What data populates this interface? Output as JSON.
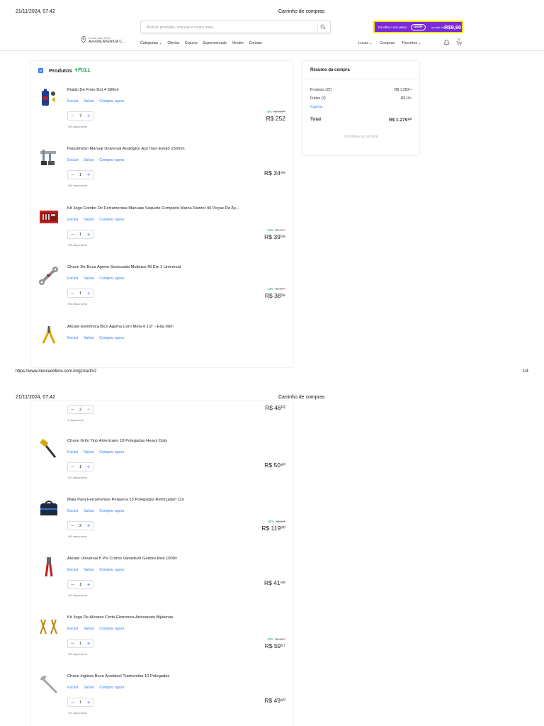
{
  "print": {
    "datetime": "21/11/2024, 07:42",
    "title": "Carrinho de compras",
    "url": "https://www.mercadolivre.com.br/gz/cart/v2",
    "page_label": "1/4"
  },
  "header": {
    "search_placeholder": "Buscar produtos, marcas e muito mais…",
    "promo_text": "Escolha o seu plano",
    "promo_pill": "meli+",
    "promo_from": "a partir de",
    "promo_price": "R$9,90",
    "address_line1": "Enviar para VEIA",
    "address_line2": "Avenida AVENIDA C...",
    "nav": [
      "Categorias ⌄",
      "Ofertas",
      "Cupons",
      "Supermercado",
      "Vender",
      "Contato"
    ],
    "user_nav": [
      "Lucas ⌄",
      "Compras",
      "Favoritos ⌄"
    ],
    "cart_label": "22"
  },
  "cart": {
    "title": "Produtos",
    "full_badge": "FULL",
    "items_page1": [
      {
        "title": "Fluido De Freio Dot 4 500ml",
        "qty": "7",
        "available": "+50 disponíveis",
        "discount": "-8%",
        "old_price": "R$ 283⁰⁰",
        "price": "R$ 252",
        "actions": [
          "Excluir",
          "Salvar",
          "Comprar agora"
        ]
      },
      {
        "title": "Paquímetro Manual Universal Analógico Aço Inox Estojo 150mm",
        "qty": "1",
        "available": "+50 disponíveis",
        "discount": "",
        "old_price": "",
        "price": "R$ 34⁹⁹",
        "actions": [
          "Excluir",
          "Salvar",
          "Comprar agora"
        ]
      },
      {
        "title": "Kit Jogo Combo De Ferramentas Manuais Soquete Completo Marca Rezzet 46 Peças De Aç...",
        "qty": "1",
        "available": "+50 disponíveis",
        "discount": "-12%",
        "old_price": "R$ 44⁹⁹",
        "price": "R$ 39⁵⁹",
        "actions": [
          "Excluir",
          "Salvar",
          "Comprar agora"
        ]
      },
      {
        "title": "Chave De Boca Aperto Sextavada Multiuso 48 Em 1 Universal",
        "qty": "1",
        "available": "+50 disponíveis",
        "discount": "-13%",
        "old_price": "R$ 43⁹⁰",
        "price": "R$ 38¹⁸",
        "actions": [
          "Excluir",
          "Salvar",
          "Comprar agora"
        ]
      },
      {
        "title": "Alicate Eletrônica Bico Agulha Com Mola 4 1/2\" - Eda 0bm",
        "actions": [
          "Excluir",
          "Salvar",
          "Comprar agora"
        ]
      }
    ],
    "partial_item_page2": {
      "qty": "2",
      "available": "2 disponíveis",
      "price": "R$ 46⁰²"
    },
    "items_page2": [
      {
        "title": "Chave Grifo Tipo Americano 18 Polegadas Heavy Duty",
        "qty": "1",
        "available": "+10 disponíveis",
        "discount": "",
        "old_price": "",
        "price": "R$ 50⁹⁰",
        "actions": [
          "Excluir",
          "Salvar",
          "Comprar agora"
        ]
      },
      {
        "title": "Mala Para Ferramentas Pequena 13 Polegadas Reforçada!! Cor",
        "qty": "2",
        "available": "+50 disponíveis",
        "discount": "-30%",
        "old_price": "R$ 340",
        "price": "R$ 119⁰⁰",
        "actions": [
          "Excluir",
          "Salvar",
          "Comprar agora"
        ]
      },
      {
        "title": "Alicate Universal 8 Pol Cromo Vanadium Gedore Red 1000v",
        "qty": "1",
        "available": "+10 disponíveis",
        "discount": "",
        "old_price": "",
        "price": "R$ 41⁹⁹",
        "actions": [
          "Excluir",
          "Salvar",
          "Comprar agora"
        ]
      },
      {
        "title": "Kit Jogo De Alicates Corte Eletronica Artesanato Bijuterias",
        "qty": "1",
        "available": "+50 disponíveis",
        "discount": "-10%",
        "old_price": "R$ 66⁰⁰",
        "price": "R$ 59⁵⁷",
        "actions": [
          "Excluir",
          "Salvar",
          "Comprar agora"
        ]
      },
      {
        "title": "Chave Inglesa Boca Ajustável Tramontina 10 Polegadas",
        "qty": "1",
        "available": "+10 disponíveis",
        "discount": "",
        "old_price": "",
        "price": "R$ 49⁹⁰",
        "actions": [
          "Excluir",
          "Salvar",
          "Comprar agora"
        ]
      }
    ]
  },
  "summary": {
    "title": "Resumo da compra",
    "products_label": "Produtos (22)",
    "products_value": "R$ 1.263¹⁸",
    "shipping_label": "Fretes (3)",
    "shipping_value": "R$ 16⁶",
    "coupon_label": "Cupons",
    "total_label": "Total",
    "total_value": "R$ 1.279⁸⁰",
    "continue_label": "Continuar a compra"
  },
  "colors": {
    "accent": "#3483fa",
    "green": "#00a650",
    "promo_purple": "#7a2bd6",
    "promo_border": "#f5e400"
  }
}
